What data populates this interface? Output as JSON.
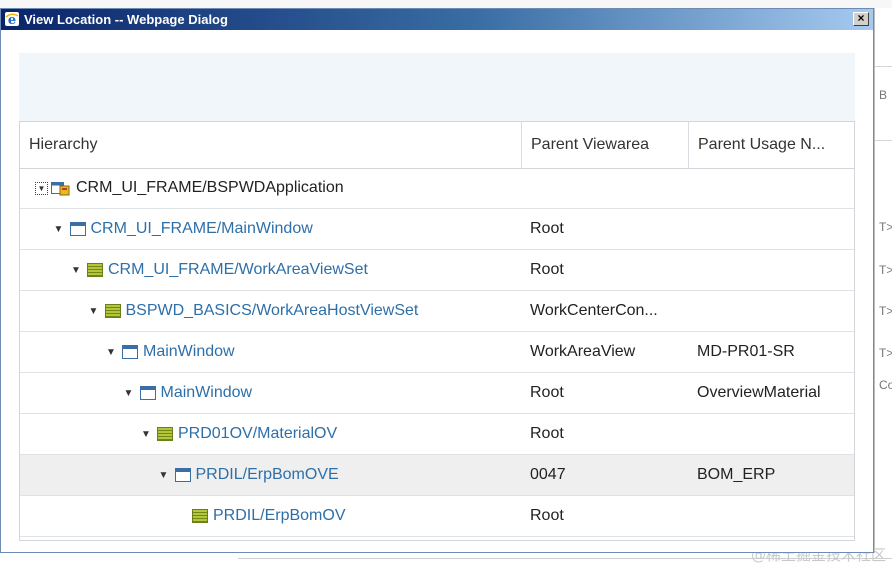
{
  "dialog": {
    "title": "View Location -- Webpage Dialog",
    "close_label": "×"
  },
  "columns": [
    "Hierarchy",
    "Parent Viewarea",
    "Parent Usage N..."
  ],
  "rows": [
    {
      "label": "CRM_UI_FRAME/BSPWDApplication",
      "viewarea": "",
      "usage": "",
      "icon": "application-icon",
      "level": 0,
      "link": false,
      "toggle": "expanded-boxed"
    },
    {
      "label": "CRM_UI_FRAME/MainWindow",
      "viewarea": "Root",
      "usage": "",
      "icon": "window-icon",
      "level": 1,
      "link": true,
      "toggle": "expanded"
    },
    {
      "label": "CRM_UI_FRAME/WorkAreaViewSet",
      "viewarea": "Root",
      "usage": "",
      "icon": "viewset-icon",
      "level": 2,
      "link": true,
      "toggle": "expanded"
    },
    {
      "label": "BSPWD_BASICS/WorkAreaHostViewSet",
      "viewarea": "WorkCenterCon...",
      "usage": "",
      "icon": "viewset-icon",
      "level": 3,
      "link": true,
      "toggle": "expanded"
    },
    {
      "label": "MainWindow",
      "viewarea": "WorkAreaView",
      "usage": "MD-PR01-SR",
      "icon": "window-icon",
      "level": 4,
      "link": true,
      "toggle": "expanded"
    },
    {
      "label": "MainWindow",
      "viewarea": "Root",
      "usage": "OverviewMaterial",
      "icon": "window-icon",
      "level": 5,
      "link": true,
      "toggle": "expanded"
    },
    {
      "label": "PRD01OV/MaterialOV",
      "viewarea": "Root",
      "usage": "",
      "icon": "viewset-icon",
      "level": 6,
      "link": true,
      "toggle": "expanded"
    },
    {
      "label": "PRDIL/ErpBomOVE",
      "viewarea": "0047",
      "usage": "BOM_ERP",
      "icon": "window-icon",
      "level": 7,
      "link": true,
      "toggle": "expanded",
      "selected": true
    },
    {
      "label": "PRDIL/ErpBomOV",
      "viewarea": "Root",
      "usage": "",
      "icon": "viewset-icon",
      "level": 8,
      "link": true,
      "toggle": "none"
    }
  ],
  "background": {
    "right_fragments": [
      "B",
      "T>",
      "T>",
      "T>",
      "T>",
      "Co"
    ],
    "watermark": "@稀土掘金技术社区"
  },
  "colors": {
    "title_gradient_start": "#0a246a",
    "title_gradient_end": "#a6caf0",
    "link": "#2e6fa8",
    "header_band": "#f1f6fa",
    "selected_row": "#efefef"
  }
}
